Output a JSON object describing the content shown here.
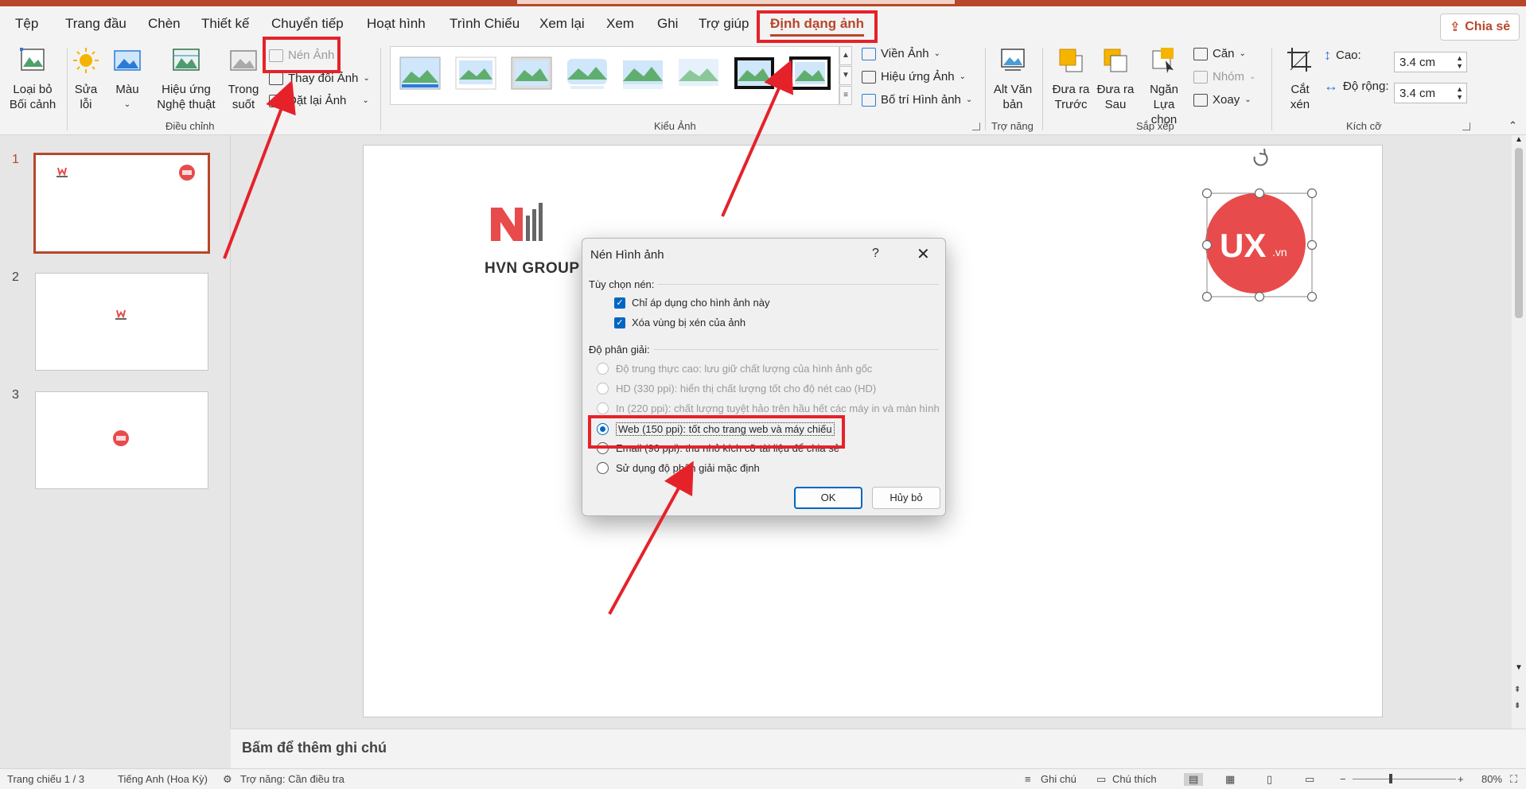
{
  "tabs": [
    "Tệp",
    "Trang đầu",
    "Chèn",
    "Thiết kế",
    "Chuyển tiếp",
    "Hoạt hình",
    "Trình Chiếu",
    "Xem lại",
    "Xem",
    "Ghi",
    "Trợ giúp",
    "Định dạng ảnh"
  ],
  "share_label": "Chia sẻ",
  "ribbon": {
    "remove_bg": [
      "Loại bỏ",
      "Bối cảnh"
    ],
    "corrections": [
      "Sửa",
      "lỗi"
    ],
    "color": "Màu",
    "artistic": [
      "Hiệu ứng",
      "Nghệ thuật"
    ],
    "transparency": [
      "Trong",
      "suốt"
    ],
    "compress": "Nén Ảnh",
    "change_picture": "Thay đổi Ảnh",
    "reset_picture": "Đặt lại Ảnh",
    "group_adjust": "Điều chỉnh",
    "group_styles": "Kiểu Ảnh",
    "picture_border": "Viền Ảnh",
    "picture_effects": "Hiệu ứng Ảnh",
    "picture_layout": "Bố trí Hình ảnh",
    "alt_text": [
      "Alt Văn",
      "bản"
    ],
    "group_access": "Trợ năng",
    "bring_forward": [
      "Đưa ra",
      "Trước"
    ],
    "send_backward": [
      "Đưa ra",
      "Sau"
    ],
    "selection_pane": [
      "Ngăn",
      "Lựa chọn"
    ],
    "align": "Căn",
    "group": "Nhóm",
    "rotate": "Xoay",
    "group_arrange": "Sắp xếp",
    "crop": [
      "Cắt",
      "xén"
    ],
    "height_label": "Cao:",
    "height_value": "3.4 cm",
    "width_label": "Độ rộng:",
    "width_value": "3.4 cm",
    "group_size": "Kích cỡ"
  },
  "slides": [
    "1",
    "2",
    "3"
  ],
  "slide": {
    "logo_text": "HVN GROUP",
    "badge_text": "UX",
    "badge_suffix": ".vn"
  },
  "dialog": {
    "title": "Nén Hình ảnh",
    "help": "?",
    "close": "✕",
    "compress_options": "Tùy chọn nén:",
    "apply_only": "Chỉ áp dụng cho hình ảnh này",
    "delete_cropped": "Xóa vùng bị xén của ảnh",
    "resolution": "Độ phân giải:",
    "options": [
      "Độ trung thực cao: lưu giữ chất lượng của hình ảnh gốc",
      "HD (330 ppi): hiển thị chất lượng tốt cho độ nét cao (HD)",
      "In (220 ppi): chất lượng tuyệt hảo trên hầu hết các máy in và màn hình",
      "Web (150 ppi): tốt cho trang web và máy chiếu",
      "Email (96 ppi): thu nhỏ kích cỡ tài liệu để chia sẻ",
      "Sử dụng độ phân giải mặc định"
    ],
    "ok": "OK",
    "cancel": "Hủy bỏ"
  },
  "notes_placeholder": "Bấm để thêm ghi chú",
  "status": {
    "slide_count": "Trang chiếu 1 / 3",
    "language": "Tiếng Anh (Hoa Kỳ)",
    "accessibility": "Trợ năng: Cần điều tra",
    "notes": "Ghi chú",
    "comments": "Chú thích",
    "zoom": "80%"
  },
  "colors": {
    "accent": "#b7472a",
    "annotation": "#e5222a",
    "badge": "#e84b4b",
    "dialog_blue": "#0067c0"
  }
}
